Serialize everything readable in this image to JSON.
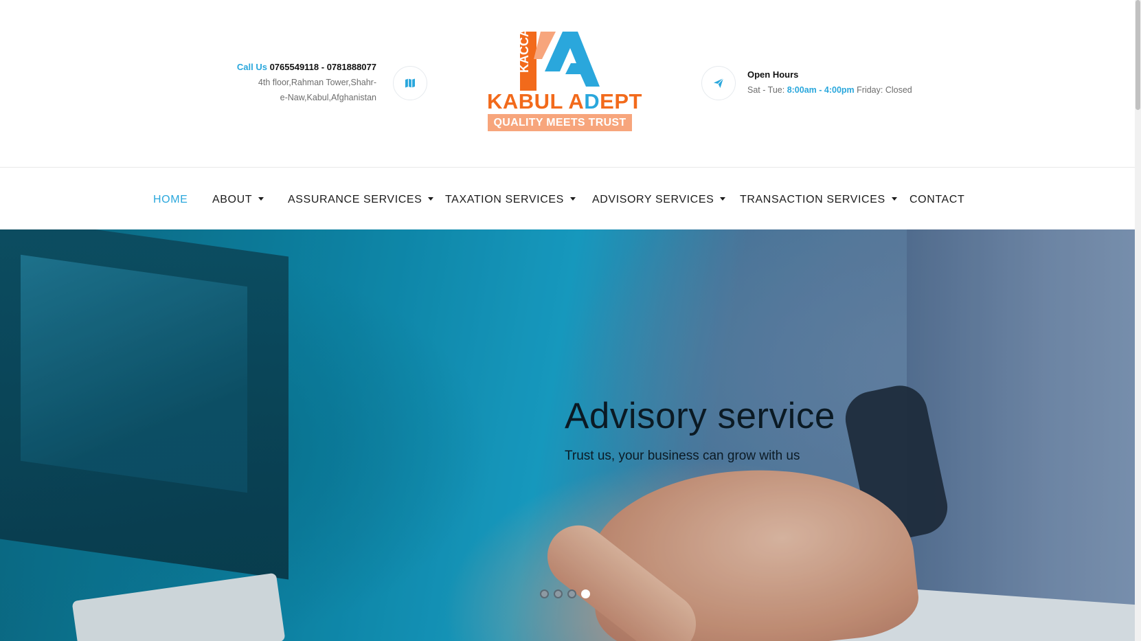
{
  "header": {
    "call_label": "Call Us",
    "phones": "0765549118 - 0781888077",
    "address_line1": "4th floor,Rahman Tower,Shahr-",
    "address_line2": "e-Naw,Kabul,Afghanistan",
    "hours_title": "Open Hours",
    "hours_days": "Sat - Tue:",
    "hours_time": "8:00am - 4:00pm",
    "hours_friday": "Friday: Closed"
  },
  "logo": {
    "mark_text": "KACCA",
    "brand_part1": "KABUL A",
    "brand_part2": "D",
    "brand_part3": "EPT",
    "tagline": "QUALITY MEETS TRUST"
  },
  "icons": {
    "map": "map-icon",
    "send": "paper-plane-icon"
  },
  "nav": {
    "items": [
      {
        "label": "HOME",
        "active": true,
        "dropdown": false
      },
      {
        "label": "ABOUT",
        "active": false,
        "dropdown": true
      },
      {
        "label": "ASSURANCE SERVICES",
        "active": false,
        "dropdown": true
      },
      {
        "label": "TAXATION SERVICES",
        "active": false,
        "dropdown": true
      },
      {
        "label": "ADVISORY SERVICES",
        "active": false,
        "dropdown": true
      },
      {
        "label": "TRANSACTION SERVICES",
        "active": false,
        "dropdown": true
      },
      {
        "label": "CONTACT",
        "active": false,
        "dropdown": false
      }
    ]
  },
  "hero": {
    "title": "Advisory service",
    "subtitle": "Trust us, your business can grow with us",
    "slide_count": 4,
    "active_slide": 4
  },
  "colors": {
    "accent": "#2aa7dc",
    "brand_orange": "#f26a1b",
    "tag_peach": "#f7a57c"
  }
}
